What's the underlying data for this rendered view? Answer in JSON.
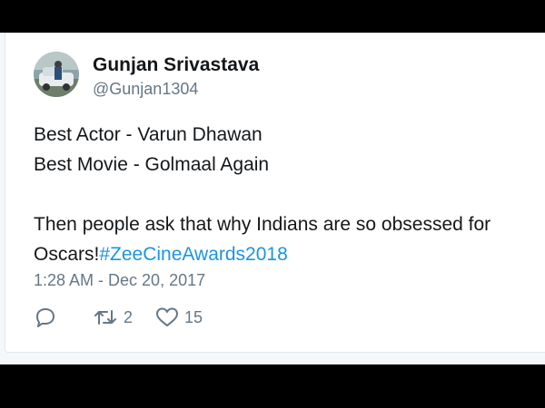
{
  "tweet": {
    "display_name": "Gunjan Srivastava",
    "handle": "@Gunjan1304",
    "lines": [
      "Best Actor - Varun Dhawan",
      "Best Movie - Golmaal Again",
      "",
      "Then people ask that why Indians are so obsessed for"
    ],
    "last_line_text": "Oscars!",
    "hashtag": "#ZeeCineAwards2018",
    "timestamp": "1:28 AM - Dec 20, 2017",
    "retweet_count": "2",
    "like_count": "15"
  },
  "colors": {
    "link": "#1b95e0",
    "secondary_text": "#657786",
    "primary_text": "#14171a"
  },
  "icons": {
    "reply": "speech-bubble-icon",
    "retweet": "retweet-arrows-icon",
    "like": "heart-icon"
  }
}
